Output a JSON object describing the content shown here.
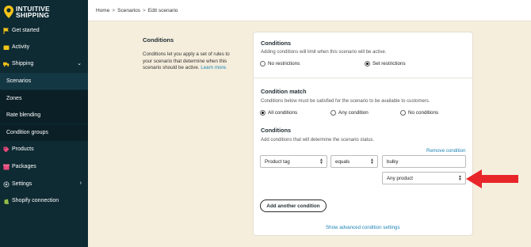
{
  "brand": {
    "line1": "INTUITIVE",
    "line2": "SHIPPING"
  },
  "breadcrumb": {
    "home": "Home",
    "sep1": ">",
    "scenarios": "Scenarios",
    "sep2": ">",
    "current": "Edit scenario"
  },
  "sidebar": {
    "items": [
      {
        "label": "Get started",
        "icon": "flag-icon"
      },
      {
        "label": "Activity",
        "icon": "wallet-icon"
      },
      {
        "label": "Shipping",
        "icon": "truck-icon"
      },
      {
        "label": "Scenarios"
      },
      {
        "label": "Zones"
      },
      {
        "label": "Rate blending"
      },
      {
        "label": "Condition groups"
      },
      {
        "label": "Products",
        "icon": "tag-icon"
      },
      {
        "label": "Packages",
        "icon": "box-icon"
      },
      {
        "label": "Settings",
        "icon": "gear-icon"
      },
      {
        "label": "Shopify connection",
        "icon": "shopify-icon"
      }
    ]
  },
  "description": {
    "title": "Conditions",
    "text": "Conditions let you apply a set of rules to your scenario that determine when this scenario should be active.",
    "link": "Learn more."
  },
  "card": {
    "conditions": {
      "title": "Conditions",
      "subtitle": "Adding conditions will limit when this scenario will be active.",
      "options": [
        "No restrictions",
        "Set restrictions"
      ],
      "selected": "Set restrictions"
    },
    "match": {
      "title": "Condition match",
      "subtitle": "Conditions below must be satisfied for the scenario to be available to customers.",
      "options": [
        "All conditions",
        "Any condition",
        "No conditions"
      ],
      "selected": "All conditions"
    },
    "rules": {
      "title": "Conditions",
      "subtitle": "Add conditions that will determine the scenario status.",
      "remove_label": "Remove condition",
      "field_value": "Product tag",
      "operator_value": "equals",
      "text_value": "bulky",
      "scope_value": "Any product",
      "add_label": "Add another condition",
      "advanced_label": "Show advanced condition settings"
    }
  },
  "colors": {
    "sidebar": "#0e2a33",
    "accent_link": "#1d84b5",
    "arrow": "#e8262a",
    "background": "#f5eedd",
    "logo": "#f5c518"
  }
}
